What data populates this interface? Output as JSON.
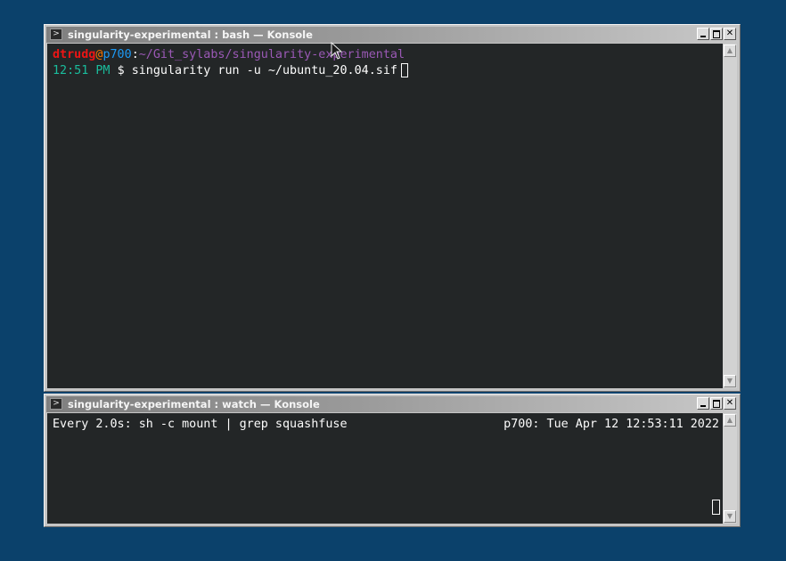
{
  "window_top": {
    "title": "singularity-experimental : bash — Konsole",
    "prompt": {
      "user": "dtrudg",
      "at": "@",
      "host": "p700",
      "colon": ":",
      "path": "~/Git_sylabs/singularity-experimental",
      "time": "12:51 PM",
      "symbol": "$",
      "command": "singularity run -u ~/ubuntu_20.04.sif"
    }
  },
  "window_bottom": {
    "title": "singularity-experimental : watch — Konsole",
    "watch_header_left": "Every 2.0s: sh -c mount | grep squashfuse",
    "watch_header_right": "p700: Tue Apr 12 12:53:11 2022"
  },
  "icons": {
    "terminal": "terminal-icon",
    "minimize": "minimize-icon",
    "maximize": "maximize-icon",
    "close": "close-icon",
    "scroll_up": "scroll-up-icon",
    "scroll_down": "scroll-down-icon",
    "pointer": "mouse-pointer-icon"
  },
  "glyphs": {
    "terminal": ">",
    "close": "✕",
    "up": "▲",
    "down": "▼"
  },
  "colors": {
    "desktop": "#0b416b",
    "terminal_bg": "#232627",
    "user": "#ed1515",
    "at": "#f67400",
    "host": "#1d99f3",
    "path": "#9b59b6",
    "time": "#1abc9c"
  }
}
